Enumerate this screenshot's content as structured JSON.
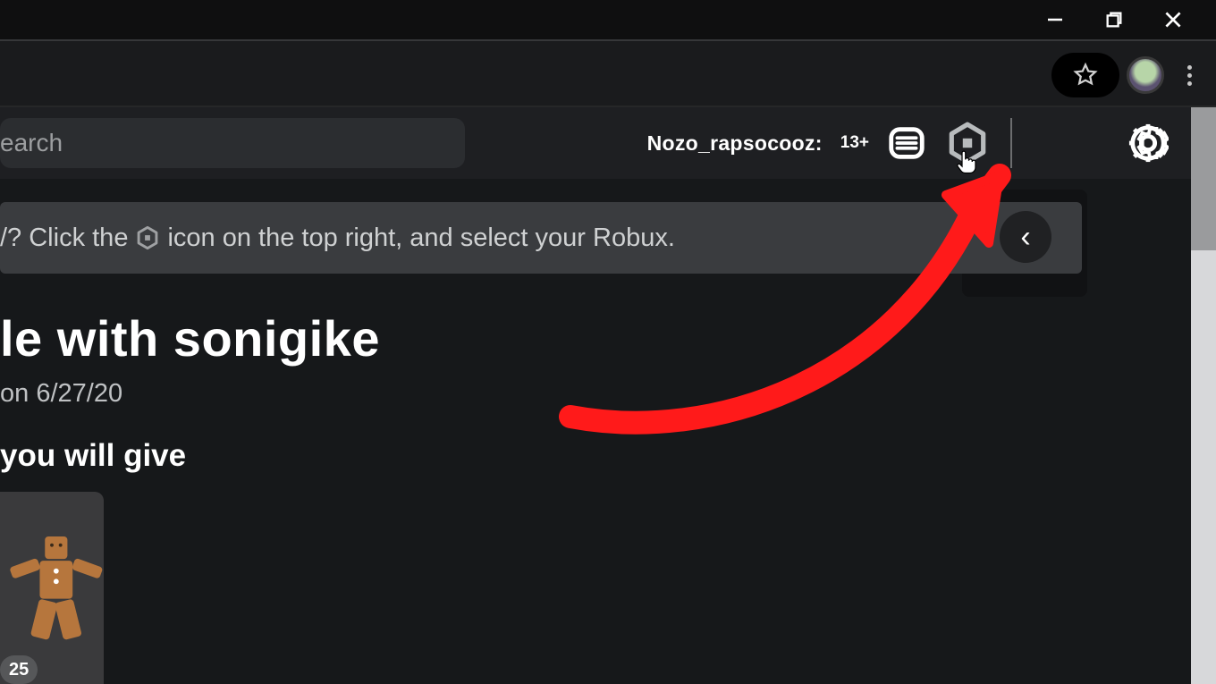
{
  "window_controls": {
    "minimize": "minimize",
    "maximize": "maximize",
    "close": "close"
  },
  "browser": {
    "star_tooltip": "Bookmark",
    "menu_tooltip": "Menu"
  },
  "search": {
    "placeholder": "earch"
  },
  "user": {
    "name": "Nozo_rapsocooz:",
    "age_badge": "13+"
  },
  "topbar_icons": {
    "messages": "messages-icon",
    "robux": "robux-icon",
    "settings": "settings-icon"
  },
  "banner": {
    "prefix": "/? Click the",
    "icon_name": "robux-hex-icon",
    "suffix": "icon on the top right, and select your Robux."
  },
  "nav": {
    "chevron": "‹"
  },
  "trade": {
    "title_fragment": "le with sonigike",
    "expires_fragment": "on 6/27/20",
    "you_give_fragment": "you will give",
    "item_qty": "25"
  },
  "annotation": {
    "arrow_color": "#ff1a1a"
  }
}
